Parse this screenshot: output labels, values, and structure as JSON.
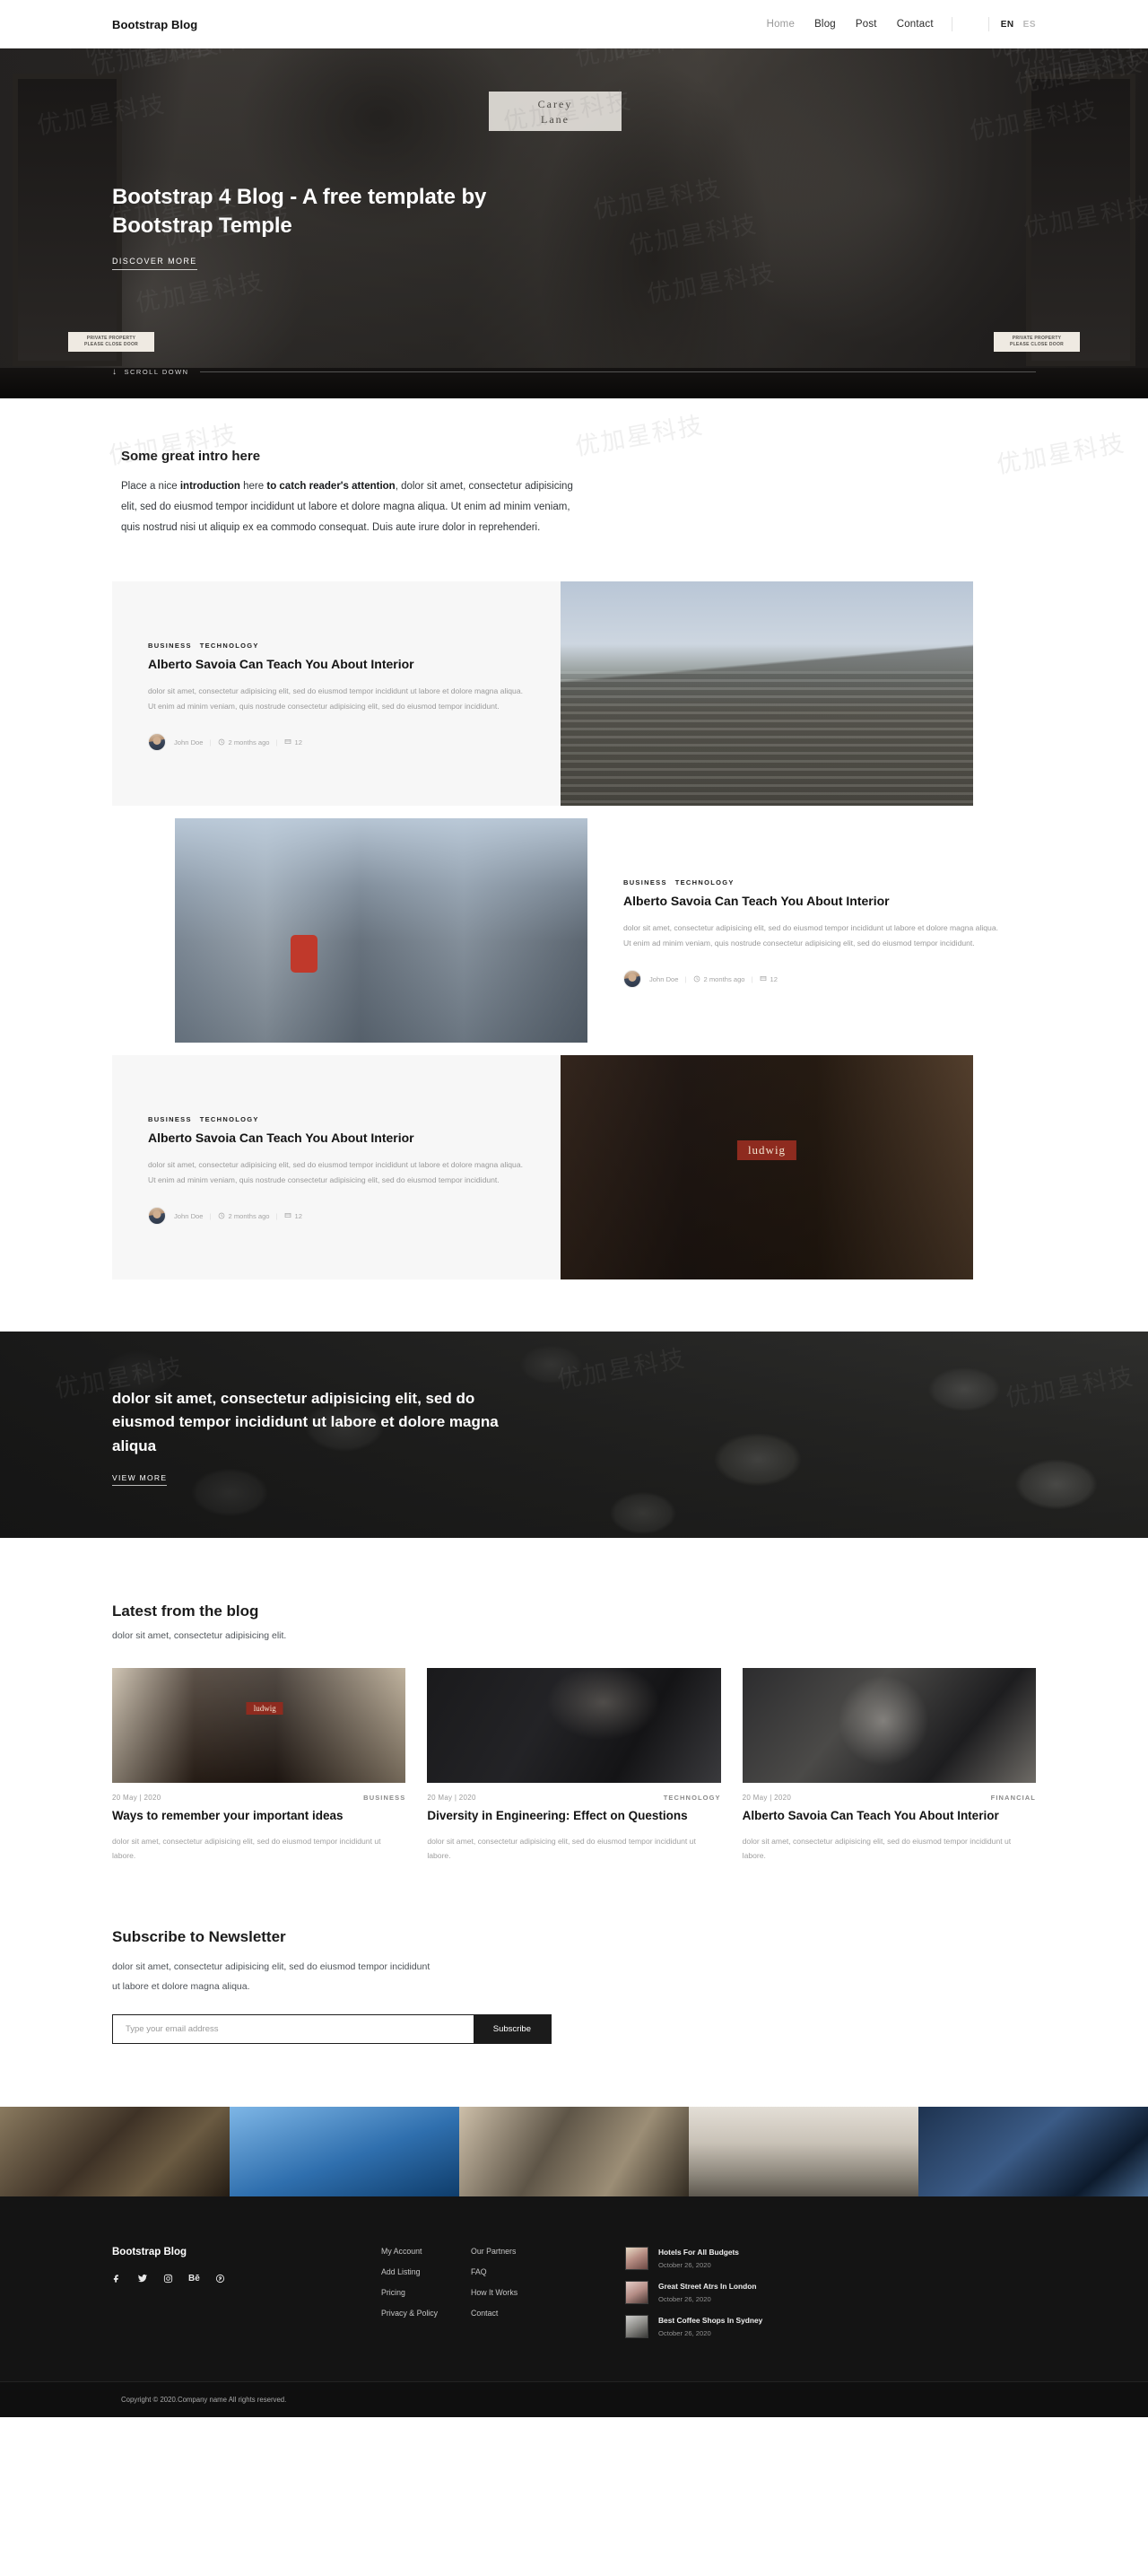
{
  "header": {
    "brand": "Bootstrap Blog",
    "nav": [
      {
        "label": "Home",
        "active": true
      },
      {
        "label": "Blog",
        "active": false
      },
      {
        "label": "Post",
        "active": false
      },
      {
        "label": "Contact",
        "active": false
      }
    ],
    "search_icon": "search-icon",
    "languages": [
      {
        "label": "EN",
        "selected": true
      },
      {
        "label": "ES",
        "selected": false
      }
    ]
  },
  "hero": {
    "sign_left_line1": "PRIVATE PROPERTY",
    "sign_left_line2": "PLEASE CLOSE DOOR",
    "sign_right_line1": "PRIVATE PROPERTY",
    "sign_right_line2": "PLEASE CLOSE DOOR",
    "plaque_line1": "Carey",
    "plaque_line2": "Lane",
    "title": "Bootstrap 4 Blog - A free template by Bootstrap Temple",
    "cta": "DISCOVER MORE",
    "scroll": "SCROLL DOWN",
    "scroll_icon": "arrow-down-icon"
  },
  "intro": {
    "heading": "Some great intro here",
    "text_1": "Place a nice ",
    "text_bold_1": "introduction",
    "text_2": " here ",
    "text_bold_2": "to catch reader's attention",
    "text_3": ", dolor sit amet, consectetur adipisicing elit, sed do eiusmod tempor incididunt ut labore et dolore magna aliqua. Ut enim ad minim veniam, quis nostrud nisi ut aliquip ex ea commodo consequat. Duis aute irure dolor in reprehenderi."
  },
  "featured": [
    {
      "categories": [
        "BUSINESS",
        "TECHNOLOGY"
      ],
      "title": "Alberto Savoia Can Teach You About Interior",
      "excerpt": "dolor sit amet, consectetur adipisicing elit, sed do eiusmod tempor incididunt ut labore et dolore magna aliqua. Ut enim ad minim veniam, quis nostrude consectetur adipisicing elit, sed do eiusmod tempor incididunt.",
      "author": "John Doe",
      "time": "2 months ago",
      "comments": "12",
      "image": "railway-tracks-photo"
    },
    {
      "categories": [
        "BUSINESS",
        "TECHNOLOGY"
      ],
      "title": "Alberto Savoia Can Teach You About Interior",
      "excerpt": "dolor sit amet, consectetur adipisicing elit, sed do eiusmod tempor incididunt ut labore et dolore magna aliqua. Ut enim ad minim veniam, quis nostrude consectetur adipisicing elit, sed do eiusmod tempor incididunt.",
      "author": "John Doe",
      "time": "2 months ago",
      "comments": "12",
      "image": "city-street-backpackers-photo"
    },
    {
      "categories": [
        "BUSINESS",
        "TECHNOLOGY"
      ],
      "title": "Alberto Savoia Can Teach You About Interior",
      "excerpt": "dolor sit amet, consectetur adipisicing elit, sed do eiusmod tempor incididunt ut labore et dolore magna aliqua. Ut enim ad minim veniam, quis nostrude consectetur adipisicing elit, sed do eiusmod tempor incididunt.",
      "author": "John Doe",
      "time": "2 months ago",
      "comments": "12",
      "image": "ludwig-cafe-storefront-photo"
    }
  ],
  "banner": {
    "title": "dolor sit amet, consectetur adipisicing elit, sed do eiusmod tempor incididunt ut labore et dolore magna aliqua",
    "cta": "VIEW MORE"
  },
  "latest": {
    "heading": "Latest from the blog",
    "subheading": "dolor sit amet, consectetur adipisicing elit.",
    "cards": [
      {
        "date": "20 May | 2020",
        "category": "BUSINESS",
        "title": "Ways to remember your important ideas",
        "excerpt": "dolor sit amet, consectetur adipisicing elit, sed do eiusmod tempor incididunt ut labore.",
        "image": "ludwig-cafe-bicycles-photo"
      },
      {
        "date": "20 May | 2020",
        "category": "TECHNOLOGY",
        "title": "Diversity in Engineering: Effect on Questions",
        "excerpt": "dolor sit amet, consectetur adipisicing elit, sed do eiusmod tempor incididunt ut labore.",
        "image": "desk-laptop-notebook-photo"
      },
      {
        "date": "20 May | 2020",
        "category": "FINANCIAL",
        "title": "Alberto Savoia Can Teach You About Interior",
        "excerpt": "dolor sit amet, consectetur adipisicing elit, sed do eiusmod tempor incididunt ut labore.",
        "image": "barista-coffee-shop-photo"
      }
    ]
  },
  "newsletter": {
    "heading": "Subscribe to Newsletter",
    "text": "dolor sit amet, consectetur adipisicing elit, sed do eiusmod tempor incididunt ut labore et dolore magna aliqua.",
    "placeholder": "Type your email address",
    "button": "Subscribe"
  },
  "gallery": [
    "market-vendor-photo",
    "blue-door-photo",
    "street-crowd-photo",
    "road-walker-photo",
    "glass-building-photo"
  ],
  "footer": {
    "brand": "Bootstrap Blog",
    "socials": [
      {
        "name": "facebook-icon",
        "glyph": "f"
      },
      {
        "name": "twitter-icon",
        "glyph": "t"
      },
      {
        "name": "instagram-icon",
        "glyph": "i"
      },
      {
        "name": "behance-icon",
        "glyph": "Bē"
      },
      {
        "name": "pinterest-icon",
        "glyph": "p"
      }
    ],
    "links_col1": [
      "My Account",
      "Add Listing",
      "Pricing",
      "Privacy & Policy"
    ],
    "links_col2": [
      "Our Partners",
      "FAQ",
      "How It Works",
      "Contact"
    ],
    "posts": [
      {
        "title": "Hotels For All Budgets",
        "date": "October 26, 2020"
      },
      {
        "title": "Great Street Atrs In London",
        "date": "October 26, 2020"
      },
      {
        "title": "Best Coffee Shops In Sydney",
        "date": "October 26, 2020"
      }
    ],
    "copyright": "Copyright © 2020.Company name All rights reserved."
  },
  "colors": {
    "dark": "#141414",
    "accent": "#1b1b1b",
    "muted": "#9a9a9a"
  }
}
